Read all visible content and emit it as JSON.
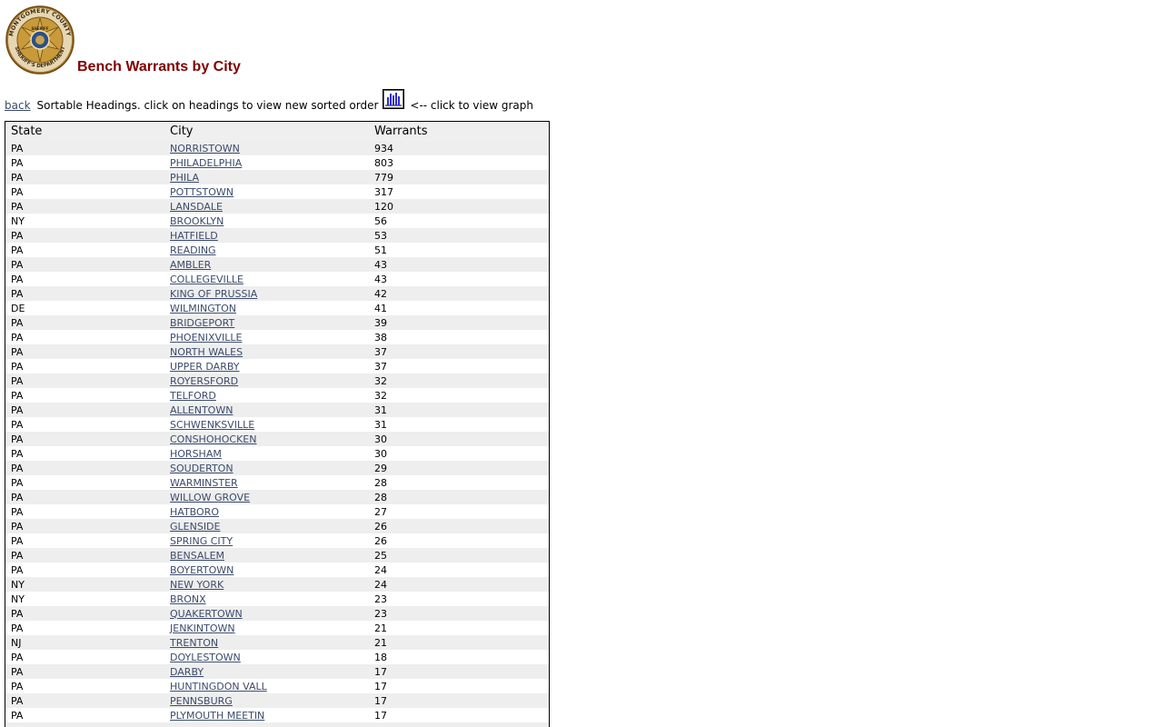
{
  "header": {
    "badge_text_top": "MONTGOMERY COUNTY",
    "badge_text_bottom": "SHERIFF'S DEPARTMENT",
    "badge_center": "SHERIFF",
    "title": "Bench Warrants by City"
  },
  "colors": {
    "title": "#800000",
    "link": "#3b4b6b",
    "row_alt": "#eeeeee",
    "header_bg": "#efefef",
    "graph_icon": "#2b2bd0"
  },
  "toolbar": {
    "back_label": "back",
    "instructions": "Sortable Headings. click on headings to view new sorted order",
    "graph_icon": "bar-chart-icon",
    "graph_hint": "<-- click to view graph"
  },
  "table": {
    "headers": [
      "State",
      "City",
      "Warrants"
    ],
    "rows": [
      {
        "state": "PA",
        "city": "NORRISTOWN",
        "warrants": "934"
      },
      {
        "state": "PA",
        "city": "PHILADELPHIA",
        "warrants": "803"
      },
      {
        "state": "PA",
        "city": "PHILA",
        "warrants": "779"
      },
      {
        "state": "PA",
        "city": "POTTSTOWN",
        "warrants": "317"
      },
      {
        "state": "PA",
        "city": "LANSDALE",
        "warrants": "120"
      },
      {
        "state": "NY",
        "city": "BROOKLYN",
        "warrants": "56"
      },
      {
        "state": "PA",
        "city": "HATFIELD",
        "warrants": "53"
      },
      {
        "state": "PA",
        "city": "READING",
        "warrants": "51"
      },
      {
        "state": "PA",
        "city": "AMBLER",
        "warrants": "43"
      },
      {
        "state": "PA",
        "city": "COLLEGEVILLE",
        "warrants": "43"
      },
      {
        "state": "PA",
        "city": "KING OF PRUSSIA",
        "warrants": "42"
      },
      {
        "state": "DE",
        "city": "WILMINGTON",
        "warrants": "41"
      },
      {
        "state": "PA",
        "city": "BRIDGEPORT",
        "warrants": "39"
      },
      {
        "state": "PA",
        "city": "PHOENIXVILLE",
        "warrants": "38"
      },
      {
        "state": "PA",
        "city": "NORTH WALES",
        "warrants": "37"
      },
      {
        "state": "PA",
        "city": "UPPER DARBY",
        "warrants": "37"
      },
      {
        "state": "PA",
        "city": "ROYERSFORD",
        "warrants": "32"
      },
      {
        "state": "PA",
        "city": "TELFORD",
        "warrants": "32"
      },
      {
        "state": "PA",
        "city": "ALLENTOWN",
        "warrants": "31"
      },
      {
        "state": "PA",
        "city": "SCHWENKSVILLE",
        "warrants": "31"
      },
      {
        "state": "PA",
        "city": "CONSHOHOCKEN",
        "warrants": "30"
      },
      {
        "state": "PA",
        "city": "HORSHAM",
        "warrants": "30"
      },
      {
        "state": "PA",
        "city": "SOUDERTON",
        "warrants": "29"
      },
      {
        "state": "PA",
        "city": "WARMINSTER",
        "warrants": "28"
      },
      {
        "state": "PA",
        "city": "WILLOW GROVE",
        "warrants": "28"
      },
      {
        "state": "PA",
        "city": "HATBORO",
        "warrants": "27"
      },
      {
        "state": "PA",
        "city": "GLENSIDE",
        "warrants": "26"
      },
      {
        "state": "PA",
        "city": "SPRING CITY",
        "warrants": "26"
      },
      {
        "state": "PA",
        "city": "BENSALEM",
        "warrants": "25"
      },
      {
        "state": "PA",
        "city": "BOYERTOWN",
        "warrants": "24"
      },
      {
        "state": "NY",
        "city": "NEW YORK",
        "warrants": "24"
      },
      {
        "state": "NY",
        "city": "BRONX",
        "warrants": "23"
      },
      {
        "state": "PA",
        "city": "QUAKERTOWN",
        "warrants": "23"
      },
      {
        "state": "PA",
        "city": "JENKINTOWN",
        "warrants": "21"
      },
      {
        "state": "NJ",
        "city": "TRENTON",
        "warrants": "21"
      },
      {
        "state": "PA",
        "city": "DOYLESTOWN",
        "warrants": "18"
      },
      {
        "state": "PA",
        "city": "DARBY",
        "warrants": "17"
      },
      {
        "state": "PA",
        "city": "HUNTINGDON VALL",
        "warrants": "17"
      },
      {
        "state": "PA",
        "city": "PENNSBURG",
        "warrants": "17"
      },
      {
        "state": "PA",
        "city": "PLYMOUTH MEETIN",
        "warrants": "17"
      },
      {
        "state": "",
        "city": "",
        "warrants": ""
      }
    ]
  }
}
